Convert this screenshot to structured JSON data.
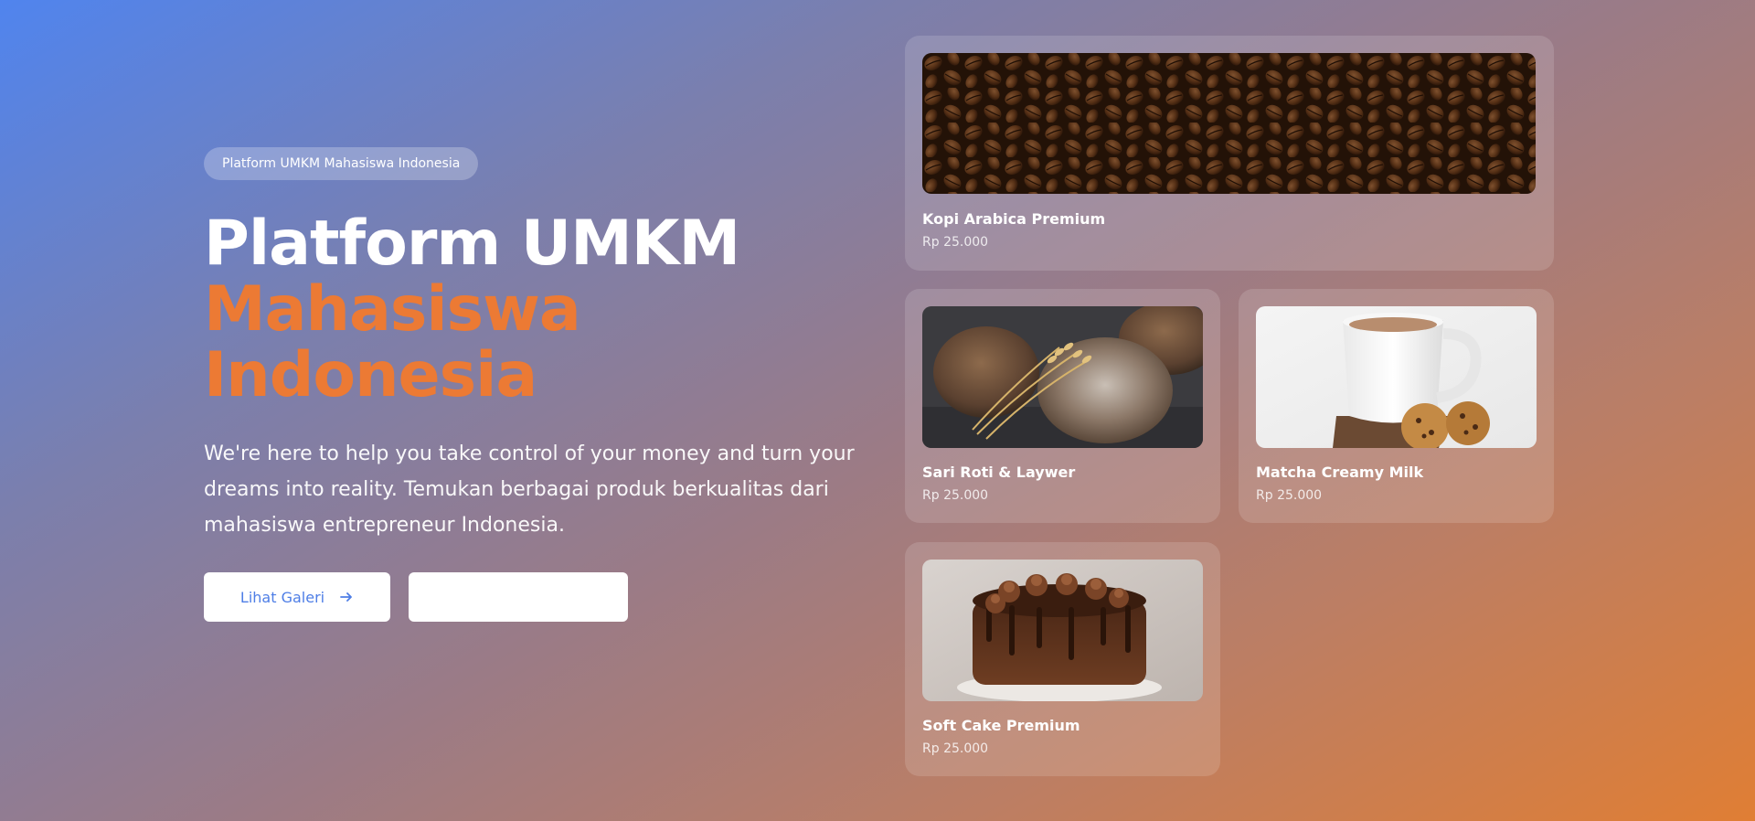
{
  "hero": {
    "badge": "Platform UMKM Mahasiswa Indonesia",
    "title_line1": "Platform UMKM",
    "title_line2": "Mahasiswa",
    "title_line3": "Indonesia",
    "description": "We're here to help you take control of your money and turn your dreams into reality. Temukan berbagai produk berkualitas dari mahasiswa entrepreneur Indonesia.",
    "primary_button": "Lihat Galeri",
    "secondary_button": ""
  },
  "products": [
    {
      "name": "Kopi Arabica Premium",
      "price": "Rp 25.000",
      "image": "coffee-beans"
    },
    {
      "name": "Sari Roti & Laywer",
      "price": "Rp 25.000",
      "image": "bread-loaves"
    },
    {
      "name": "Matcha Creamy Milk",
      "price": "Rp 25.000",
      "image": "milk-tea-cup"
    },
    {
      "name": "Soft Cake Premium",
      "price": "Rp 25.000",
      "image": "chocolate-cake"
    }
  ],
  "colors": {
    "accent_orange": "#ec7a34",
    "button_text_blue": "#4e7ee6"
  }
}
